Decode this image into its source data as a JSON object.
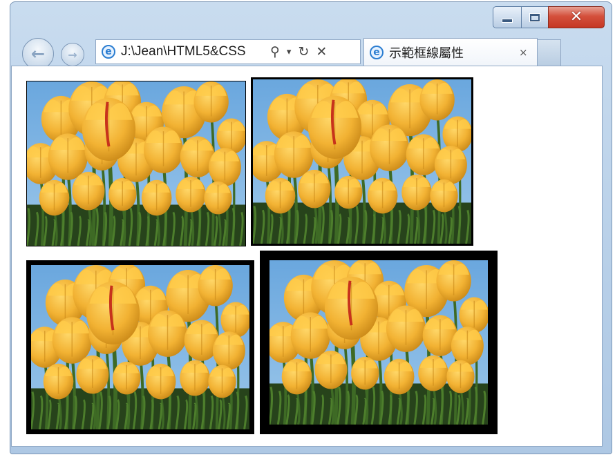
{
  "window": {
    "controls": [
      "minimize",
      "maximize",
      "close"
    ],
    "close_glyph": "✕"
  },
  "nav": {
    "back_icon": "arrow-left-icon",
    "forward_icon": "arrow-right-icon"
  },
  "address": {
    "value": "J:\\Jean\\HTML5&CSS",
    "search_glyph": "⚲",
    "dropdown_glyph": "▾",
    "refresh_glyph": "↻",
    "stop_glyph": "✕"
  },
  "tab": {
    "title": "示範框線屬性",
    "close_glyph": "×"
  },
  "images": [
    {
      "border_style": "thin",
      "color": "#000000"
    },
    {
      "border_style": "medium",
      "color": "#000000"
    },
    {
      "border_style": "thick",
      "color": "#000000"
    },
    {
      "border_style": "extra-thick",
      "color": "#000000"
    }
  ],
  "palette": {
    "sky": "#6aa7de",
    "petal": "#f2b233",
    "petal_shadow": "#c98817",
    "stem": "#3e6a25",
    "ground": "#27431b",
    "chrome": "#b7cfe8",
    "close_red": "#c53724"
  }
}
